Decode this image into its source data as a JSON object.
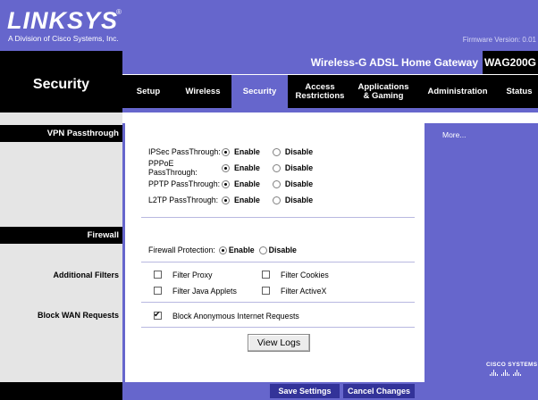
{
  "header": {
    "logo": "LINKSYS",
    "logo_reg": "®",
    "subtitle": "A Division of Cisco Systems, Inc.",
    "firmware": "Firmware Version: 0.01"
  },
  "page_title": "Security",
  "product": {
    "name": "Wireless-G ADSL Home Gateway",
    "model": "WAG200G"
  },
  "tabs": [
    {
      "label": "Setup"
    },
    {
      "label": "Wireless"
    },
    {
      "label": "Security"
    },
    {
      "label": "Access\nRestrictions"
    },
    {
      "label": "Applications\n& Gaming"
    },
    {
      "label": "Administration"
    },
    {
      "label": "Status"
    }
  ],
  "sections": {
    "vpn": "VPN Passthrough",
    "firewall": "Firewall",
    "additional_filters": "Additional Filters",
    "block_wan": "Block WAN Requests"
  },
  "vpn_rows": [
    {
      "label": "IPSec PassThrough:",
      "selected": "Enable"
    },
    {
      "label": "PPPoE PassThrough:",
      "selected": "Enable"
    },
    {
      "label": "PPTP PassThrough:",
      "selected": "Enable"
    },
    {
      "label": "L2TP PassThrough:",
      "selected": "Enable"
    }
  ],
  "options": {
    "enable": "Enable",
    "disable": "Disable"
  },
  "firewall": {
    "label": "Firewall Protection:",
    "selected": "Enable"
  },
  "filters": {
    "proxy": {
      "label": "Filter Proxy",
      "checked": false
    },
    "cookies": {
      "label": "Filter Cookies",
      "checked": false
    },
    "java": {
      "label": "Filter Java Applets",
      "checked": false
    },
    "activex": {
      "label": "Filter ActiveX",
      "checked": false
    }
  },
  "block_anonymous": {
    "label": "Block Anonymous Internet Requests",
    "checked": true
  },
  "buttons": {
    "view_logs": "View Logs",
    "save": "Save Settings",
    "cancel": "Cancel Changes"
  },
  "right_panel": {
    "more": "More..."
  },
  "cisco": "Cisco Systems",
  "colors": {
    "accent": "#6666cc",
    "dark": "#000000",
    "button": "#333399"
  }
}
